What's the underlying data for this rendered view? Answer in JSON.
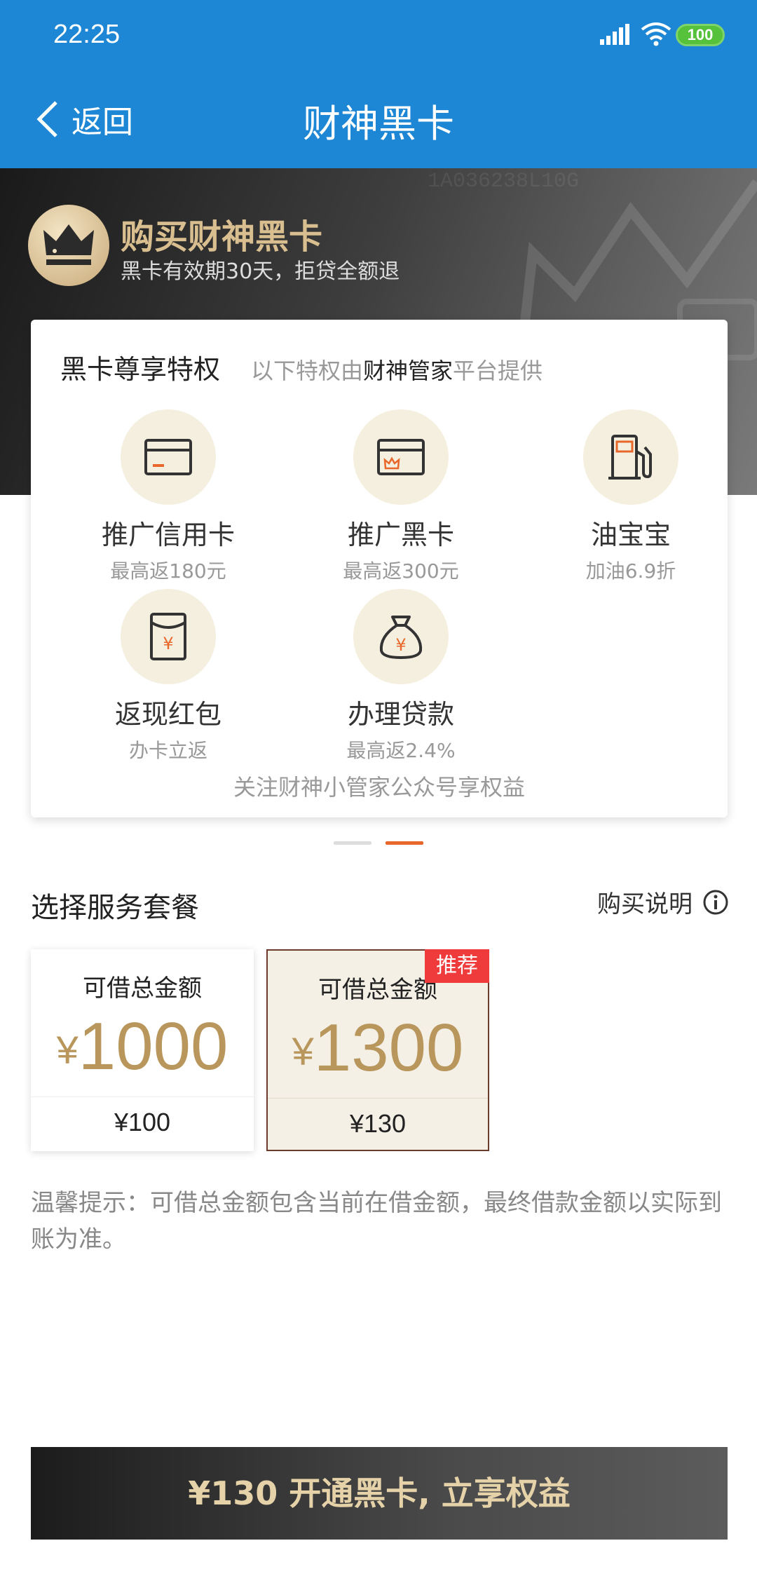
{
  "status_bar": {
    "time": "22:25",
    "battery": "100",
    "colors": {
      "battery": "#56c13a"
    }
  },
  "nav": {
    "back_label": "返回",
    "title": "财神黑卡",
    "colors": {
      "background": "#1d87d6"
    }
  },
  "banner": {
    "serial": "1A036238L10G",
    "title": "购买财神黑卡",
    "subtitle": "黑卡有效期30天，拒贷全额退",
    "colors": {
      "title": "#d9bf8f"
    }
  },
  "privileges": {
    "heading": "黑卡尊享特权",
    "sub_prefix": "以下特权由",
    "sub_highlight": "财神管家",
    "sub_suffix": "平台提供",
    "items": [
      {
        "icon": "credit-card-icon",
        "name": "推广信用卡",
        "desc": "最高返180元"
      },
      {
        "icon": "black-card-icon",
        "name": "推广黑卡",
        "desc": "最高返300元"
      },
      {
        "icon": "fuel-pump-icon",
        "name": "油宝宝",
        "desc": "加油6.9折"
      },
      {
        "icon": "red-envelope-icon",
        "name": "返现红包",
        "desc": "办卡立返"
      },
      {
        "icon": "money-bag-icon",
        "name": "办理贷款",
        "desc": "最高返2.4%"
      }
    ],
    "footer": "关注财神小管家公众号享权益"
  },
  "carousel": {
    "pages": 2,
    "active": 2
  },
  "packages": {
    "section_title": "选择服务套餐",
    "info_label": "购买说明",
    "items": [
      {
        "label": "可借总金额",
        "currency": "¥",
        "amount": "1000",
        "price": "¥100",
        "selected": false
      },
      {
        "label": "可借总金额",
        "currency": "¥",
        "amount": "1300",
        "price": "¥130",
        "selected": true,
        "badge": "推荐"
      }
    ],
    "colors": {
      "amount": "#b8965c",
      "badge": "#ef3b3b",
      "selected_border": "#6b3a2a"
    }
  },
  "tip": "温馨提示：可借总金额包含当前在借金额，最终借款金额以实际到账为准。",
  "cta": {
    "label": "¥130 开通黑卡, 立享权益",
    "colors": {
      "text": "#e6d2a8"
    }
  }
}
